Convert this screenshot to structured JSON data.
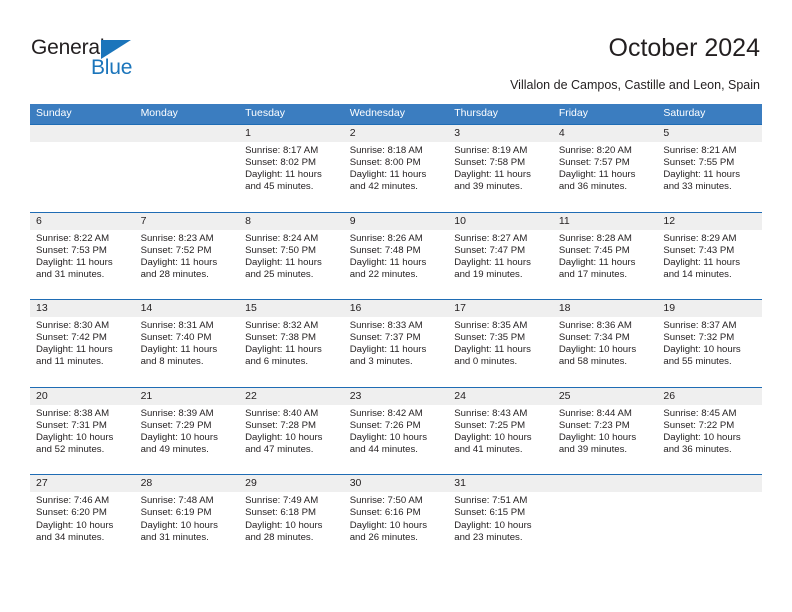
{
  "brand": {
    "name_top": "General",
    "name_bottom": "Blue",
    "accent_color": "#1b75bb"
  },
  "header": {
    "title": "October 2024",
    "subtitle": "Villalon de Campos, Castille and Leon, Spain"
  },
  "calendar": {
    "header_bg": "#3b7dc0",
    "row_border_color": "#1f6cb4",
    "daynum_band_bg": "#efefef",
    "weekdays": [
      "Sunday",
      "Monday",
      "Tuesday",
      "Wednesday",
      "Thursday",
      "Friday",
      "Saturday"
    ],
    "weeks": [
      [
        {
          "day": "",
          "sunrise": "",
          "sunset": "",
          "daylight_1": "",
          "daylight_2": ""
        },
        {
          "day": "",
          "sunrise": "",
          "sunset": "",
          "daylight_1": "",
          "daylight_2": ""
        },
        {
          "day": "1",
          "sunrise": "Sunrise: 8:17 AM",
          "sunset": "Sunset: 8:02 PM",
          "daylight_1": "Daylight: 11 hours",
          "daylight_2": "and 45 minutes."
        },
        {
          "day": "2",
          "sunrise": "Sunrise: 8:18 AM",
          "sunset": "Sunset: 8:00 PM",
          "daylight_1": "Daylight: 11 hours",
          "daylight_2": "and 42 minutes."
        },
        {
          "day": "3",
          "sunrise": "Sunrise: 8:19 AM",
          "sunset": "Sunset: 7:58 PM",
          "daylight_1": "Daylight: 11 hours",
          "daylight_2": "and 39 minutes."
        },
        {
          "day": "4",
          "sunrise": "Sunrise: 8:20 AM",
          "sunset": "Sunset: 7:57 PM",
          "daylight_1": "Daylight: 11 hours",
          "daylight_2": "and 36 minutes."
        },
        {
          "day": "5",
          "sunrise": "Sunrise: 8:21 AM",
          "sunset": "Sunset: 7:55 PM",
          "daylight_1": "Daylight: 11 hours",
          "daylight_2": "and 33 minutes."
        }
      ],
      [
        {
          "day": "6",
          "sunrise": "Sunrise: 8:22 AM",
          "sunset": "Sunset: 7:53 PM",
          "daylight_1": "Daylight: 11 hours",
          "daylight_2": "and 31 minutes."
        },
        {
          "day": "7",
          "sunrise": "Sunrise: 8:23 AM",
          "sunset": "Sunset: 7:52 PM",
          "daylight_1": "Daylight: 11 hours",
          "daylight_2": "and 28 minutes."
        },
        {
          "day": "8",
          "sunrise": "Sunrise: 8:24 AM",
          "sunset": "Sunset: 7:50 PM",
          "daylight_1": "Daylight: 11 hours",
          "daylight_2": "and 25 minutes."
        },
        {
          "day": "9",
          "sunrise": "Sunrise: 8:26 AM",
          "sunset": "Sunset: 7:48 PM",
          "daylight_1": "Daylight: 11 hours",
          "daylight_2": "and 22 minutes."
        },
        {
          "day": "10",
          "sunrise": "Sunrise: 8:27 AM",
          "sunset": "Sunset: 7:47 PM",
          "daylight_1": "Daylight: 11 hours",
          "daylight_2": "and 19 minutes."
        },
        {
          "day": "11",
          "sunrise": "Sunrise: 8:28 AM",
          "sunset": "Sunset: 7:45 PM",
          "daylight_1": "Daylight: 11 hours",
          "daylight_2": "and 17 minutes."
        },
        {
          "day": "12",
          "sunrise": "Sunrise: 8:29 AM",
          "sunset": "Sunset: 7:43 PM",
          "daylight_1": "Daylight: 11 hours",
          "daylight_2": "and 14 minutes."
        }
      ],
      [
        {
          "day": "13",
          "sunrise": "Sunrise: 8:30 AM",
          "sunset": "Sunset: 7:42 PM",
          "daylight_1": "Daylight: 11 hours",
          "daylight_2": "and 11 minutes."
        },
        {
          "day": "14",
          "sunrise": "Sunrise: 8:31 AM",
          "sunset": "Sunset: 7:40 PM",
          "daylight_1": "Daylight: 11 hours",
          "daylight_2": "and 8 minutes."
        },
        {
          "day": "15",
          "sunrise": "Sunrise: 8:32 AM",
          "sunset": "Sunset: 7:38 PM",
          "daylight_1": "Daylight: 11 hours",
          "daylight_2": "and 6 minutes."
        },
        {
          "day": "16",
          "sunrise": "Sunrise: 8:33 AM",
          "sunset": "Sunset: 7:37 PM",
          "daylight_1": "Daylight: 11 hours",
          "daylight_2": "and 3 minutes."
        },
        {
          "day": "17",
          "sunrise": "Sunrise: 8:35 AM",
          "sunset": "Sunset: 7:35 PM",
          "daylight_1": "Daylight: 11 hours",
          "daylight_2": "and 0 minutes."
        },
        {
          "day": "18",
          "sunrise": "Sunrise: 8:36 AM",
          "sunset": "Sunset: 7:34 PM",
          "daylight_1": "Daylight: 10 hours",
          "daylight_2": "and 58 minutes."
        },
        {
          "day": "19",
          "sunrise": "Sunrise: 8:37 AM",
          "sunset": "Sunset: 7:32 PM",
          "daylight_1": "Daylight: 10 hours",
          "daylight_2": "and 55 minutes."
        }
      ],
      [
        {
          "day": "20",
          "sunrise": "Sunrise: 8:38 AM",
          "sunset": "Sunset: 7:31 PM",
          "daylight_1": "Daylight: 10 hours",
          "daylight_2": "and 52 minutes."
        },
        {
          "day": "21",
          "sunrise": "Sunrise: 8:39 AM",
          "sunset": "Sunset: 7:29 PM",
          "daylight_1": "Daylight: 10 hours",
          "daylight_2": "and 49 minutes."
        },
        {
          "day": "22",
          "sunrise": "Sunrise: 8:40 AM",
          "sunset": "Sunset: 7:28 PM",
          "daylight_1": "Daylight: 10 hours",
          "daylight_2": "and 47 minutes."
        },
        {
          "day": "23",
          "sunrise": "Sunrise: 8:42 AM",
          "sunset": "Sunset: 7:26 PM",
          "daylight_1": "Daylight: 10 hours",
          "daylight_2": "and 44 minutes."
        },
        {
          "day": "24",
          "sunrise": "Sunrise: 8:43 AM",
          "sunset": "Sunset: 7:25 PM",
          "daylight_1": "Daylight: 10 hours",
          "daylight_2": "and 41 minutes."
        },
        {
          "day": "25",
          "sunrise": "Sunrise: 8:44 AM",
          "sunset": "Sunset: 7:23 PM",
          "daylight_1": "Daylight: 10 hours",
          "daylight_2": "and 39 minutes."
        },
        {
          "day": "26",
          "sunrise": "Sunrise: 8:45 AM",
          "sunset": "Sunset: 7:22 PM",
          "daylight_1": "Daylight: 10 hours",
          "daylight_2": "and 36 minutes."
        }
      ],
      [
        {
          "day": "27",
          "sunrise": "Sunrise: 7:46 AM",
          "sunset": "Sunset: 6:20 PM",
          "daylight_1": "Daylight: 10 hours",
          "daylight_2": "and 34 minutes."
        },
        {
          "day": "28",
          "sunrise": "Sunrise: 7:48 AM",
          "sunset": "Sunset: 6:19 PM",
          "daylight_1": "Daylight: 10 hours",
          "daylight_2": "and 31 minutes."
        },
        {
          "day": "29",
          "sunrise": "Sunrise: 7:49 AM",
          "sunset": "Sunset: 6:18 PM",
          "daylight_1": "Daylight: 10 hours",
          "daylight_2": "and 28 minutes."
        },
        {
          "day": "30",
          "sunrise": "Sunrise: 7:50 AM",
          "sunset": "Sunset: 6:16 PM",
          "daylight_1": "Daylight: 10 hours",
          "daylight_2": "and 26 minutes."
        },
        {
          "day": "31",
          "sunrise": "Sunrise: 7:51 AM",
          "sunset": "Sunset: 6:15 PM",
          "daylight_1": "Daylight: 10 hours",
          "daylight_2": "and 23 minutes."
        },
        {
          "day": "",
          "sunrise": "",
          "sunset": "",
          "daylight_1": "",
          "daylight_2": ""
        },
        {
          "day": "",
          "sunrise": "",
          "sunset": "",
          "daylight_1": "",
          "daylight_2": ""
        }
      ]
    ]
  }
}
